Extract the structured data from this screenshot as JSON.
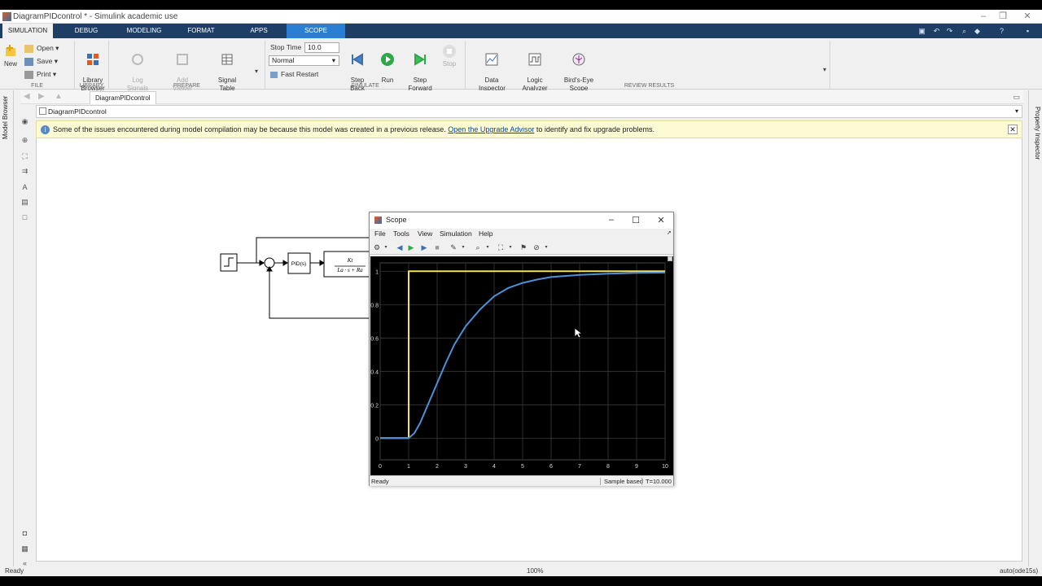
{
  "window": {
    "title": "DiagramPIDcontrol * - Simulink academic use",
    "controls": [
      "–",
      "❐",
      "✕"
    ]
  },
  "ribbon": {
    "tabs": [
      "SIMULATION",
      "DEBUG",
      "MODELING",
      "FORMAT",
      "APPS",
      "SCOPE"
    ],
    "active_tab": "SIMULATION",
    "file": {
      "new": "New",
      "open": "Open",
      "save": "Save",
      "print": "Print",
      "label": "FILE"
    },
    "library": {
      "browser": "Library\nBrowser",
      "label": "LIBRARY"
    },
    "prepare": {
      "log_signals": "Log\nSignals",
      "add_viewer": "Add\nViewer",
      "signal_table": "Signal\nTable",
      "label": "PREPARE"
    },
    "simulate": {
      "stop_time_label": "Stop Time",
      "stop_time_value": "10.0",
      "mode_value": "Normal",
      "fast_restart": "Fast Restart",
      "step_back": "Step\nBack",
      "run": "Run",
      "step_forward": "Step\nForward",
      "stop": "Stop",
      "label": "SIMULATE"
    },
    "review": {
      "data_inspector": "Data\nInspector",
      "logic_analyzer": "Logic\nAnalyzer",
      "birds_eye": "Bird's-Eye\nScope",
      "label": "REVIEW RESULTS"
    }
  },
  "model": {
    "tab": "DiagramPIDcontrol",
    "breadcrumb": "DiagramPIDcontrol"
  },
  "banner": {
    "text_before": "Some of the issues encountered during model compilation may be because this model was created in a previous release.",
    "link": "Open the Upgrade Advisor",
    "text_after": "to identify and fix upgrade problems."
  },
  "sidebars": {
    "left": "Model Browser",
    "right": "Property Inspector"
  },
  "diagram": {
    "pid_label": "PID(s)",
    "tf_num": "Kt",
    "tf_den": "La · s + Ra",
    "sum_sign": "-"
  },
  "scope": {
    "title": "Scope",
    "menu": [
      "File",
      "Tools",
      "View",
      "Simulation",
      "Help"
    ],
    "status_left": "Ready",
    "status_sample": "Sample based",
    "status_time": "T=10.000"
  },
  "chart_data": {
    "type": "line",
    "title": "",
    "xlabel": "",
    "ylabel": "",
    "xlim": [
      0,
      10
    ],
    "ylim": [
      -0.13,
      1.05
    ],
    "xticks": [
      0,
      1,
      2,
      3,
      4,
      5,
      6,
      7,
      8,
      9,
      10
    ],
    "yticks": [
      0,
      0.2,
      0.4,
      0.6,
      0.8,
      1
    ],
    "ytick_labels": [
      "0",
      "0.2",
      "0.4",
      "0.6",
      "0.8",
      "1"
    ],
    "grid": true,
    "background": "#000000",
    "series": [
      {
        "color": "#f2e44a",
        "x": [
          0,
          1,
          1,
          10
        ],
        "y": [
          0,
          0,
          1,
          1
        ]
      },
      {
        "color": "#4c90d8",
        "x": [
          0,
          1,
          1.2,
          1.4,
          1.6,
          1.8,
          2,
          2.3,
          2.6,
          3,
          3.5,
          4,
          4.5,
          5,
          5.5,
          6,
          7,
          8,
          9,
          10
        ],
        "y": [
          0,
          0,
          0.03,
          0.09,
          0.17,
          0.25,
          0.33,
          0.45,
          0.56,
          0.67,
          0.77,
          0.85,
          0.9,
          0.93,
          0.95,
          0.965,
          0.978,
          0.985,
          0.99,
          0.992
        ]
      }
    ]
  },
  "statusbar": {
    "left": "Ready",
    "zoom": "100%",
    "solver": "auto(ode15s)"
  }
}
